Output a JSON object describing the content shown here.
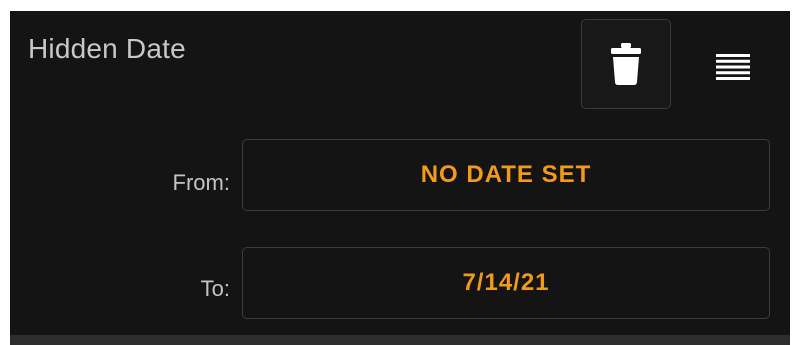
{
  "header": {
    "title": "Hidden Date"
  },
  "actions": {
    "delete_icon": "trash-icon",
    "menu_icon": "menu-lines-icon"
  },
  "range": {
    "from_label": "From:",
    "from_value": "NO DATE SET",
    "to_label": "To:",
    "to_value": "7/14/21"
  },
  "colors": {
    "background": "#141414",
    "accent": "#f29a1a",
    "border": "#3d3d3d",
    "label_text": "#c4c4c4"
  }
}
